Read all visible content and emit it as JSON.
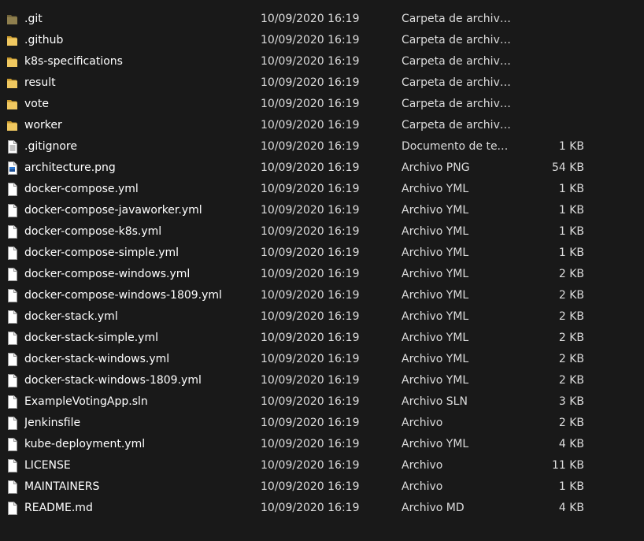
{
  "files": [
    {
      "name": ".git",
      "date": "10/09/2020 16:19",
      "type": "Carpeta de archivos",
      "size": "",
      "icon": "folder-hidden-icon"
    },
    {
      "name": ".github",
      "date": "10/09/2020 16:19",
      "type": "Carpeta de archivos",
      "size": "",
      "icon": "folder-icon"
    },
    {
      "name": "k8s-specifications",
      "date": "10/09/2020 16:19",
      "type": "Carpeta de archivos",
      "size": "",
      "icon": "folder-icon"
    },
    {
      "name": "result",
      "date": "10/09/2020 16:19",
      "type": "Carpeta de archivos",
      "size": "",
      "icon": "folder-icon"
    },
    {
      "name": "vote",
      "date": "10/09/2020 16:19",
      "type": "Carpeta de archivos",
      "size": "",
      "icon": "folder-icon"
    },
    {
      "name": "worker",
      "date": "10/09/2020 16:19",
      "type": "Carpeta de archivos",
      "size": "",
      "icon": "folder-icon"
    },
    {
      "name": ".gitignore",
      "date": "10/09/2020 16:19",
      "type": "Documento de tex...",
      "size": "1 KB",
      "icon": "text-file-icon"
    },
    {
      "name": "architecture.png",
      "date": "10/09/2020 16:19",
      "type": "Archivo PNG",
      "size": "54 KB",
      "icon": "image-file-icon"
    },
    {
      "name": "docker-compose.yml",
      "date": "10/09/2020 16:19",
      "type": "Archivo YML",
      "size": "1 KB",
      "icon": "file-icon"
    },
    {
      "name": "docker-compose-javaworker.yml",
      "date": "10/09/2020 16:19",
      "type": "Archivo YML",
      "size": "1 KB",
      "icon": "file-icon"
    },
    {
      "name": "docker-compose-k8s.yml",
      "date": "10/09/2020 16:19",
      "type": "Archivo YML",
      "size": "1 KB",
      "icon": "file-icon"
    },
    {
      "name": "docker-compose-simple.yml",
      "date": "10/09/2020 16:19",
      "type": "Archivo YML",
      "size": "1 KB",
      "icon": "file-icon"
    },
    {
      "name": "docker-compose-windows.yml",
      "date": "10/09/2020 16:19",
      "type": "Archivo YML",
      "size": "2 KB",
      "icon": "file-icon"
    },
    {
      "name": "docker-compose-windows-1809.yml",
      "date": "10/09/2020 16:19",
      "type": "Archivo YML",
      "size": "2 KB",
      "icon": "file-icon"
    },
    {
      "name": "docker-stack.yml",
      "date": "10/09/2020 16:19",
      "type": "Archivo YML",
      "size": "2 KB",
      "icon": "file-icon"
    },
    {
      "name": "docker-stack-simple.yml",
      "date": "10/09/2020 16:19",
      "type": "Archivo YML",
      "size": "2 KB",
      "icon": "file-icon"
    },
    {
      "name": "docker-stack-windows.yml",
      "date": "10/09/2020 16:19",
      "type": "Archivo YML",
      "size": "2 KB",
      "icon": "file-icon"
    },
    {
      "name": "docker-stack-windows-1809.yml",
      "date": "10/09/2020 16:19",
      "type": "Archivo YML",
      "size": "2 KB",
      "icon": "file-icon"
    },
    {
      "name": "ExampleVotingApp.sln",
      "date": "10/09/2020 16:19",
      "type": "Archivo SLN",
      "size": "3 KB",
      "icon": "file-icon"
    },
    {
      "name": "Jenkinsfile",
      "date": "10/09/2020 16:19",
      "type": "Archivo",
      "size": "2 KB",
      "icon": "file-icon"
    },
    {
      "name": "kube-deployment.yml",
      "date": "10/09/2020 16:19",
      "type": "Archivo YML",
      "size": "4 KB",
      "icon": "file-icon"
    },
    {
      "name": "LICENSE",
      "date": "10/09/2020 16:19",
      "type": "Archivo",
      "size": "11 KB",
      "icon": "file-icon"
    },
    {
      "name": "MAINTAINERS",
      "date": "10/09/2020 16:19",
      "type": "Archivo",
      "size": "1 KB",
      "icon": "file-icon"
    },
    {
      "name": "README.md",
      "date": "10/09/2020 16:19",
      "type": "Archivo MD",
      "size": "4 KB",
      "icon": "file-icon"
    }
  ],
  "colors": {
    "background": "#191919",
    "text": "#ffffff",
    "folder": "#e8c15a",
    "folder_hidden": "#8a7a4a"
  }
}
